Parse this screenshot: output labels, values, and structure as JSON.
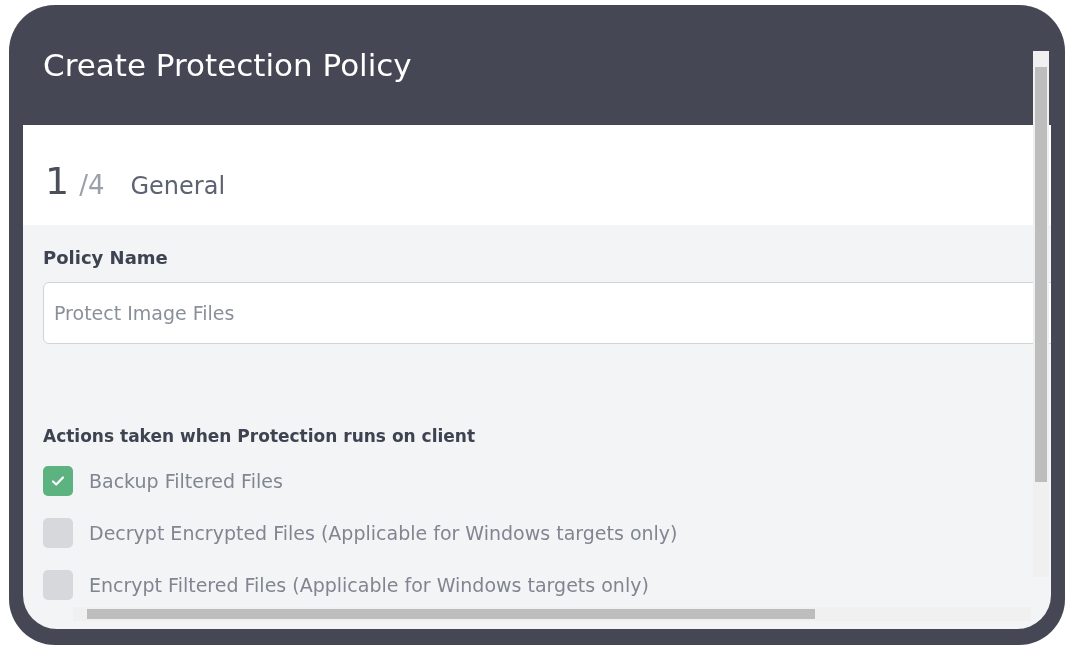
{
  "window": {
    "title": "Create Protection Policy"
  },
  "step": {
    "current": "1",
    "total": "/4",
    "name": "General"
  },
  "policy_name": {
    "label": "Policy Name",
    "placeholder": "Protect Image Files"
  },
  "actions": {
    "label": "Actions taken when Protection runs on client",
    "options": [
      {
        "label": "Backup Filtered Files",
        "checked": true
      },
      {
        "label": "Decrypt Encrypted Files (Applicable for Windows targets only)",
        "checked": false
      },
      {
        "label": "Encrypt Filtered Files (Applicable for Windows targets only)",
        "checked": false
      }
    ]
  }
}
